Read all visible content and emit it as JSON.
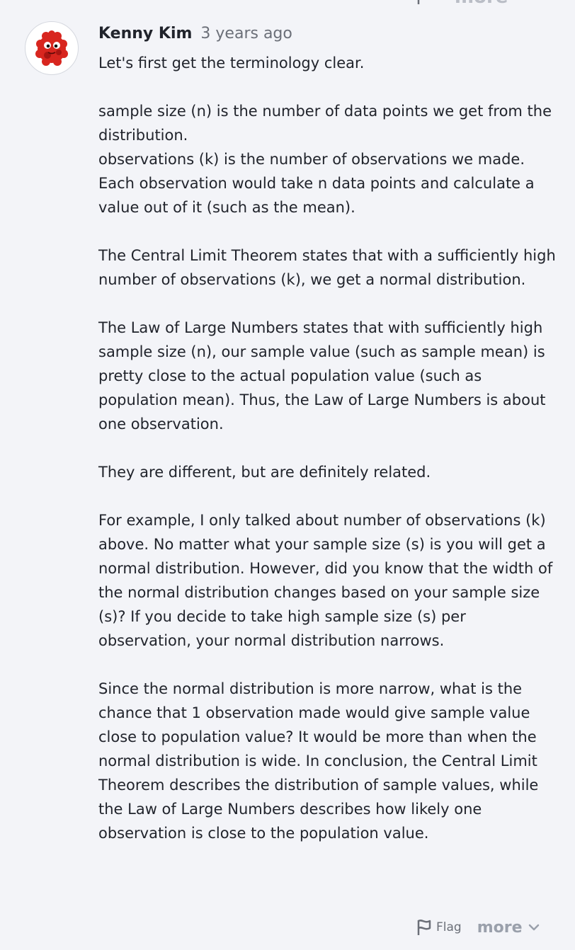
{
  "top_actions": {
    "more_label": "more"
  },
  "comment": {
    "author": "Kenny Kim",
    "time": "3 years ago",
    "paragraphs": [
      "Let's first get the terminology clear.",
      "sample size (n) is the number of data points we get from the distribution.\nobservations (k) is the number of observations we made. Each observation would take n data points and calculate a value out of it (such as the mean).",
      "The Central Limit Theorem states that with a sufficiently high number of observations (k), we get a normal distribution.",
      "The Law of Large Numbers states that with sufficiently high sample size (n), our sample value (such as sample mean) is pretty close to the actual population value (such as population mean). Thus, the Law of Large Numbers is about one observation.",
      "They are different, but are definitely related.",
      "For example, I only talked about number of observations (k) above. No matter what your sample size (s) is you will get a normal distribution. However, did you know that the width of the normal distribution changes based on your sample size (s)? If you decide to take high sample size (s) per observation, your normal distribution narrows.",
      "Since the normal distribution is more narrow, what is the chance that 1 observation made would give sample value close to population value? It would be more than when the normal distribution is wide. In conclusion, the Central Limit Theorem describes the distribution of sample values, while the Law of Large Numbers describes how likely one observation is close to the population value."
    ]
  },
  "actions": {
    "flag_label": "Flag",
    "more_label": "more"
  },
  "icons": {
    "flag": "flag-icon",
    "chevron": "chevron-down-icon",
    "avatar": "red-fuzzy-monster-avatar"
  },
  "colors": {
    "background": "#f3f4f8",
    "text": "#21242c",
    "muted": "#6b6f78",
    "more": "#9aa0ab",
    "avatar_red": "#d8261f"
  }
}
